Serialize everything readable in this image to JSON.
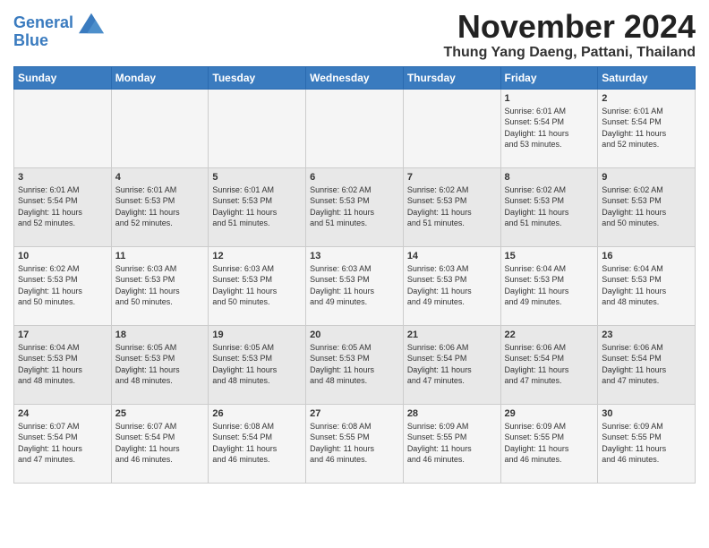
{
  "header": {
    "logo_line1": "General",
    "logo_line2": "Blue",
    "month": "November 2024",
    "location": "Thung Yang Daeng, Pattani, Thailand"
  },
  "weekdays": [
    "Sunday",
    "Monday",
    "Tuesday",
    "Wednesday",
    "Thursday",
    "Friday",
    "Saturday"
  ],
  "weeks": [
    [
      {
        "day": "",
        "info": ""
      },
      {
        "day": "",
        "info": ""
      },
      {
        "day": "",
        "info": ""
      },
      {
        "day": "",
        "info": ""
      },
      {
        "day": "",
        "info": ""
      },
      {
        "day": "1",
        "info": "Sunrise: 6:01 AM\nSunset: 5:54 PM\nDaylight: 11 hours\nand 53 minutes."
      },
      {
        "day": "2",
        "info": "Sunrise: 6:01 AM\nSunset: 5:54 PM\nDaylight: 11 hours\nand 52 minutes."
      }
    ],
    [
      {
        "day": "3",
        "info": "Sunrise: 6:01 AM\nSunset: 5:54 PM\nDaylight: 11 hours\nand 52 minutes."
      },
      {
        "day": "4",
        "info": "Sunrise: 6:01 AM\nSunset: 5:53 PM\nDaylight: 11 hours\nand 52 minutes."
      },
      {
        "day": "5",
        "info": "Sunrise: 6:01 AM\nSunset: 5:53 PM\nDaylight: 11 hours\nand 51 minutes."
      },
      {
        "day": "6",
        "info": "Sunrise: 6:02 AM\nSunset: 5:53 PM\nDaylight: 11 hours\nand 51 minutes."
      },
      {
        "day": "7",
        "info": "Sunrise: 6:02 AM\nSunset: 5:53 PM\nDaylight: 11 hours\nand 51 minutes."
      },
      {
        "day": "8",
        "info": "Sunrise: 6:02 AM\nSunset: 5:53 PM\nDaylight: 11 hours\nand 51 minutes."
      },
      {
        "day": "9",
        "info": "Sunrise: 6:02 AM\nSunset: 5:53 PM\nDaylight: 11 hours\nand 50 minutes."
      }
    ],
    [
      {
        "day": "10",
        "info": "Sunrise: 6:02 AM\nSunset: 5:53 PM\nDaylight: 11 hours\nand 50 minutes."
      },
      {
        "day": "11",
        "info": "Sunrise: 6:03 AM\nSunset: 5:53 PM\nDaylight: 11 hours\nand 50 minutes."
      },
      {
        "day": "12",
        "info": "Sunrise: 6:03 AM\nSunset: 5:53 PM\nDaylight: 11 hours\nand 50 minutes."
      },
      {
        "day": "13",
        "info": "Sunrise: 6:03 AM\nSunset: 5:53 PM\nDaylight: 11 hours\nand 49 minutes."
      },
      {
        "day": "14",
        "info": "Sunrise: 6:03 AM\nSunset: 5:53 PM\nDaylight: 11 hours\nand 49 minutes."
      },
      {
        "day": "15",
        "info": "Sunrise: 6:04 AM\nSunset: 5:53 PM\nDaylight: 11 hours\nand 49 minutes."
      },
      {
        "day": "16",
        "info": "Sunrise: 6:04 AM\nSunset: 5:53 PM\nDaylight: 11 hours\nand 48 minutes."
      }
    ],
    [
      {
        "day": "17",
        "info": "Sunrise: 6:04 AM\nSunset: 5:53 PM\nDaylight: 11 hours\nand 48 minutes."
      },
      {
        "day": "18",
        "info": "Sunrise: 6:05 AM\nSunset: 5:53 PM\nDaylight: 11 hours\nand 48 minutes."
      },
      {
        "day": "19",
        "info": "Sunrise: 6:05 AM\nSunset: 5:53 PM\nDaylight: 11 hours\nand 48 minutes."
      },
      {
        "day": "20",
        "info": "Sunrise: 6:05 AM\nSunset: 5:53 PM\nDaylight: 11 hours\nand 48 minutes."
      },
      {
        "day": "21",
        "info": "Sunrise: 6:06 AM\nSunset: 5:54 PM\nDaylight: 11 hours\nand 47 minutes."
      },
      {
        "day": "22",
        "info": "Sunrise: 6:06 AM\nSunset: 5:54 PM\nDaylight: 11 hours\nand 47 minutes."
      },
      {
        "day": "23",
        "info": "Sunrise: 6:06 AM\nSunset: 5:54 PM\nDaylight: 11 hours\nand 47 minutes."
      }
    ],
    [
      {
        "day": "24",
        "info": "Sunrise: 6:07 AM\nSunset: 5:54 PM\nDaylight: 11 hours\nand 47 minutes."
      },
      {
        "day": "25",
        "info": "Sunrise: 6:07 AM\nSunset: 5:54 PM\nDaylight: 11 hours\nand 46 minutes."
      },
      {
        "day": "26",
        "info": "Sunrise: 6:08 AM\nSunset: 5:54 PM\nDaylight: 11 hours\nand 46 minutes."
      },
      {
        "day": "27",
        "info": "Sunrise: 6:08 AM\nSunset: 5:55 PM\nDaylight: 11 hours\nand 46 minutes."
      },
      {
        "day": "28",
        "info": "Sunrise: 6:09 AM\nSunset: 5:55 PM\nDaylight: 11 hours\nand 46 minutes."
      },
      {
        "day": "29",
        "info": "Sunrise: 6:09 AM\nSunset: 5:55 PM\nDaylight: 11 hours\nand 46 minutes."
      },
      {
        "day": "30",
        "info": "Sunrise: 6:09 AM\nSunset: 5:55 PM\nDaylight: 11 hours\nand 46 minutes."
      }
    ]
  ]
}
